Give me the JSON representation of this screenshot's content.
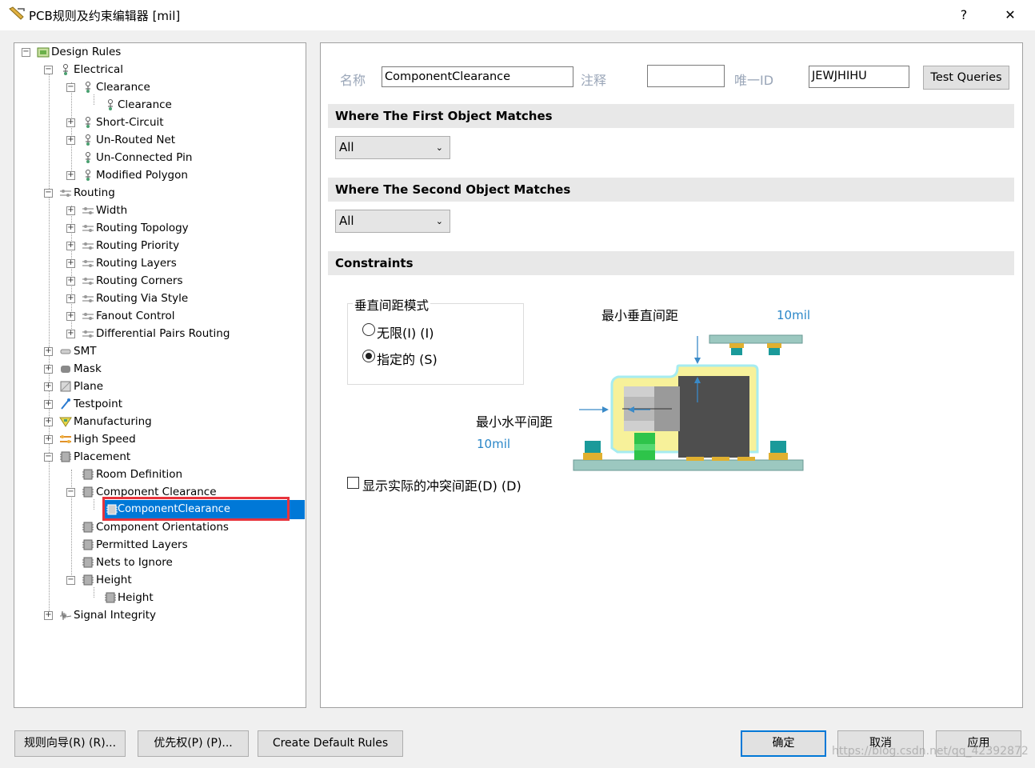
{
  "window": {
    "title": "PCB规则及约束编辑器 [mil]",
    "help": "?",
    "close": "✕"
  },
  "tree": {
    "root": "Design Rules",
    "electrical": "Electrical",
    "clearance": "Clearance",
    "clearance_child": "Clearance",
    "short_circuit": "Short-Circuit",
    "unrouted_net": "Un-Routed Net",
    "unconnected_pin": "Un-Connected Pin",
    "modified_polygon": "Modified Polygon",
    "routing": "Routing",
    "width": "Width",
    "routing_topology": "Routing Topology",
    "routing_priority": "Routing Priority",
    "routing_layers": "Routing Layers",
    "routing_corners": "Routing Corners",
    "routing_via_style": "Routing Via Style",
    "fanout_control": "Fanout Control",
    "diff_pairs_routing": "Differential Pairs Routing",
    "smt": "SMT",
    "mask": "Mask",
    "plane": "Plane",
    "testpoint": "Testpoint",
    "manufacturing": "Manufacturing",
    "high_speed": "High Speed",
    "placement": "Placement",
    "room_definition": "Room Definition",
    "component_clearance": "Component Clearance",
    "component_clearance_child": "ComponentClearance",
    "component_orientations": "Component Orientations",
    "permitted_layers": "Permitted Layers",
    "nets_to_ignore": "Nets to Ignore",
    "height": "Height",
    "height_child": "Height",
    "signal_integrity": "Signal Integrity"
  },
  "rule": {
    "name_label": "名称",
    "name_value": "ComponentClearance",
    "comment_label": "注释",
    "comment_value": "",
    "uid_label": "唯一ID",
    "uid_value": "JEWJHIHU",
    "test_queries": "Test Queries"
  },
  "first_match": {
    "header": "Where The First Object Matches",
    "value": "All"
  },
  "second_match": {
    "header": "Where The Second Object Matches",
    "value": "All"
  },
  "constraints": {
    "header": "Constraints",
    "mode_group": "垂直间距模式",
    "mode_infinite": "无限(I) (I)",
    "mode_specified": "指定的 (S)",
    "selected_mode": "指定的",
    "min_vertical_label": "最小垂直间距",
    "min_vertical_value": "10mil",
    "min_horizontal_label": "最小水平间距",
    "min_horizontal_value": "10mil",
    "show_actual_label": "显示实际的冲突间距(D) (D)",
    "show_actual_checked": false
  },
  "footer": {
    "rule_wizard": "规则向导(R) (R)...",
    "priorities": "优先权(P) (P)...",
    "create_default": "Create Default Rules",
    "ok": "确定",
    "cancel": "取消",
    "apply": "应用",
    "watermark": "https://blog.csdn.net/qq_42392872"
  },
  "colors": {
    "selection": "#0078d7",
    "highlight_box": "#e8343c",
    "accent_text": "#2a86c8"
  }
}
